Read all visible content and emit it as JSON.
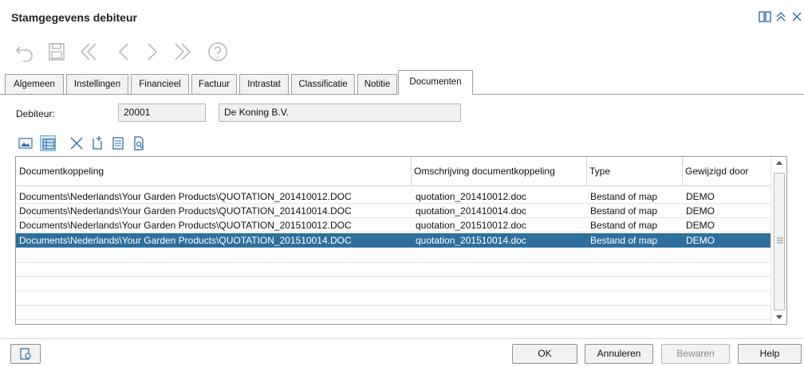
{
  "window": {
    "title": "Stamgegevens debiteur",
    "controls": {
      "layout_icon": "two-panes-icon",
      "collapse_icon": "double-chevron-up-icon",
      "close_icon": "close-icon"
    }
  },
  "toolbar": [
    {
      "name": "undo-icon"
    },
    {
      "name": "save-icon"
    },
    {
      "name": "first-record-icon"
    },
    {
      "name": "previous-record-icon"
    },
    {
      "name": "next-record-icon"
    },
    {
      "name": "last-record-icon"
    },
    {
      "name": "help-icon"
    }
  ],
  "tabs": [
    {
      "label": "Algemeen"
    },
    {
      "label": "Instellingen"
    },
    {
      "label": "Financieel"
    },
    {
      "label": "Factuur"
    },
    {
      "label": "Intrastat"
    },
    {
      "label": "Classificatie"
    },
    {
      "label": "Notitie"
    },
    {
      "label": "Documenten",
      "active": true
    }
  ],
  "debtor": {
    "label": "Debiteur:",
    "code": "20001",
    "name": "De Koning B.V."
  },
  "doc_toolbar": [
    {
      "name": "image-view-icon"
    },
    {
      "name": "list-view-icon"
    },
    {
      "name": "delete-icon"
    },
    {
      "name": "new-document-icon"
    },
    {
      "name": "properties-icon"
    },
    {
      "name": "preview-icon"
    }
  ],
  "grid": {
    "columns": [
      "Documentkoppeling",
      "Omschrijving documentkoppeling",
      "Type",
      "Gewijzigd door"
    ],
    "rows": [
      {
        "link": "Documents\\Nederlands\\Your Garden Products\\QUOTATION_201410012.DOC",
        "desc": "quotation_201410012.doc",
        "type": "Bestand of map",
        "by": "DEMO"
      },
      {
        "link": "Documents\\Nederlands\\Your Garden Products\\QUOTATION_201410014.DOC",
        "desc": "quotation_201410014.doc",
        "type": "Bestand of map",
        "by": "DEMO"
      },
      {
        "link": "Documents\\Nederlands\\Your Garden Products\\QUOTATION_201510012.DOC",
        "desc": "quotation_201510012.doc",
        "type": "Bestand of map",
        "by": "DEMO"
      },
      {
        "link": "Documents\\Nederlands\\Your Garden Products\\QUOTATION_201510014.DOC",
        "desc": "quotation_201510014.doc",
        "type": "Bestand of map",
        "by": "DEMO",
        "selected": true
      }
    ]
  },
  "footer": {
    "ok": "OK",
    "cancel": "Annuleren",
    "save": "Bewaren",
    "help": "Help",
    "left_icon": "document-settings-icon"
  }
}
